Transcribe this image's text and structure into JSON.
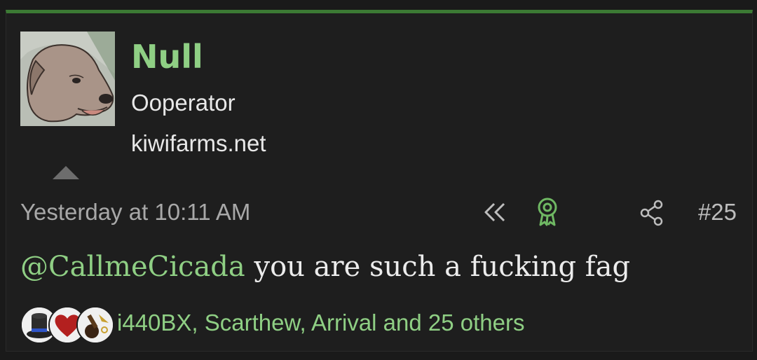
{
  "post": {
    "author": {
      "name": "Null",
      "title": "Ooperator",
      "website": "kiwifarms.net",
      "avatar_icon": "dog-avatar-image"
    },
    "timestamp": "Yesterday at 10:11 AM",
    "post_number": "#25",
    "actions": {
      "rewind_icon": "rewind-icon",
      "award_icon": "award-ribbon-icon",
      "share_icon": "share-icon"
    },
    "message": {
      "mention": "@CallmeCicada",
      "text": " you are such a fucking fag"
    },
    "reactions": {
      "icons": [
        "top-hat-icon",
        "heart-icon",
        "mortar-icon"
      ],
      "summary": "i440BX, Scarthew, Arrival and 25 others"
    },
    "colors": {
      "accent_green": "#8fcf84",
      "border_green": "#3c7a34",
      "background": "#1e1e1e"
    }
  }
}
